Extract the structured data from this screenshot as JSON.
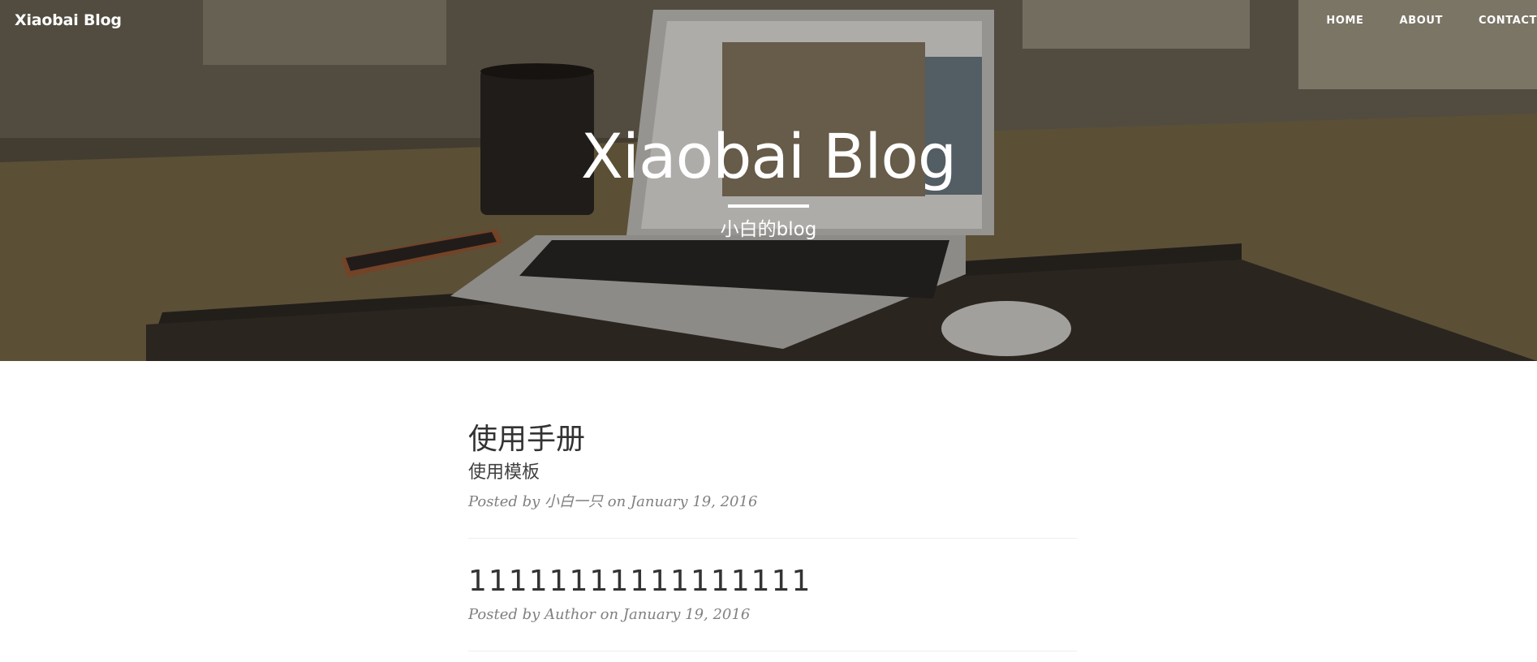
{
  "navbar": {
    "brand": "Xiaobai Blog",
    "links": [
      "HOME",
      "ABOUT",
      "CONTACT"
    ]
  },
  "hero": {
    "title": "Xiaobai Blog",
    "subtitle": "小白的blog"
  },
  "posts": [
    {
      "title": "使用手册",
      "subtitle": "使用模板",
      "meta_prefix": "Posted by",
      "author": "小白一只",
      "meta_suffix": "on January 19, 2016"
    },
    {
      "title": "11111111111111111",
      "meta_prefix": "Posted by",
      "author": "Author",
      "meta_suffix": "on January 19, 2016"
    }
  ],
  "colors": {
    "hero_overlay": "#000000",
    "text": "#404040",
    "meta": "#808080",
    "divider": "#eeeeee"
  }
}
